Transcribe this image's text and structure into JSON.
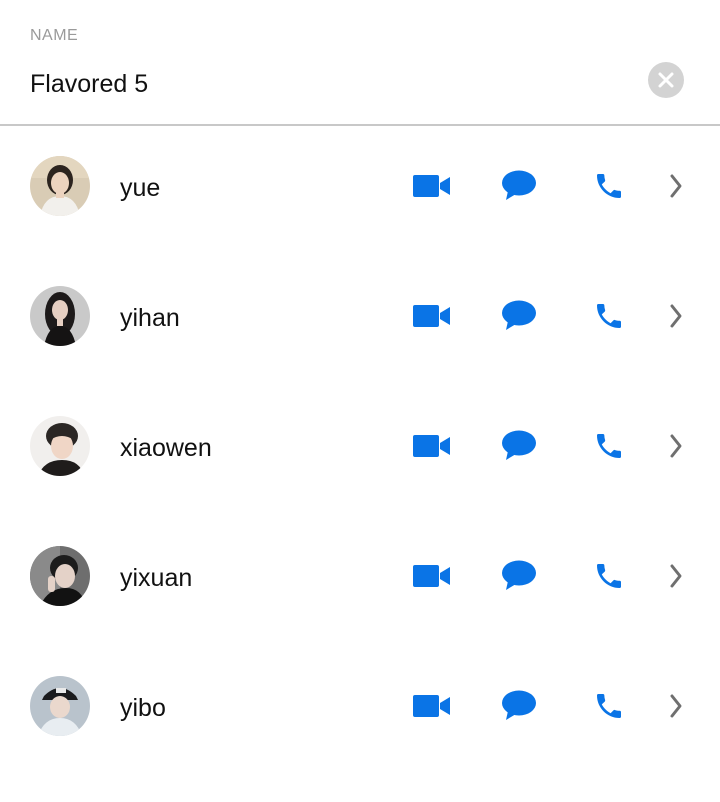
{
  "header": {
    "field_label": "NAME",
    "name_value": "Flavored 5",
    "clear_icon": "close-circle-icon"
  },
  "colors": {
    "accent": "#0a74e6",
    "chevron": "#6f6f6f",
    "divider": "#c8c8c8",
    "label": "#9a9a9a",
    "clear_button": "#d3d3d3"
  },
  "actions": {
    "video_icon": "video-camera-icon",
    "message_icon": "chat-bubble-icon",
    "call_icon": "phone-icon",
    "detail_icon": "chevron-right-icon"
  },
  "contacts": [
    {
      "name": "yue"
    },
    {
      "name": "yihan"
    },
    {
      "name": "xiaowen"
    },
    {
      "name": "yixuan"
    },
    {
      "name": "yibo"
    }
  ]
}
